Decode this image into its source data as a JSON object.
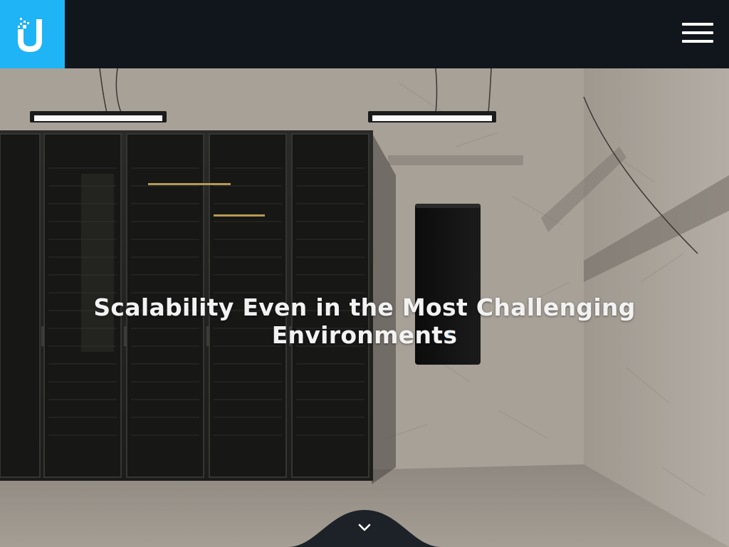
{
  "header": {
    "logo_label": "U",
    "brand_color": "#1fb4f6",
    "bar_color": "#11161c",
    "menu_icon": "hamburger-menu-icon"
  },
  "hero": {
    "title": "Scalability Even in the Most Challenging Environments",
    "scroll_icon": "chevron-down-icon"
  }
}
